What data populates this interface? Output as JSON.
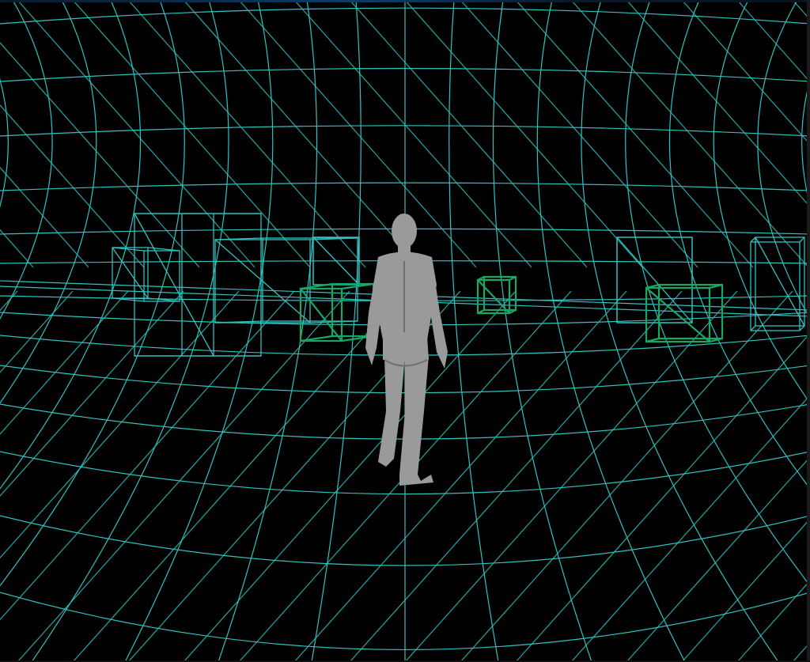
{
  "scene": {
    "background_color": "#000000",
    "wireframe_color": "#2fc3c0",
    "target_box_color": "#19a765",
    "character_color": "#9a9a9a",
    "character_shadow_color": "#6f6f6f",
    "titlebar_color": "#0a3d6e",
    "character_icon": "humanoid-mannequin-icon",
    "target_box_icon": "green-wireframe-cube-icon",
    "obstacle_box_icon": "cyan-wireframe-cube-icon"
  }
}
